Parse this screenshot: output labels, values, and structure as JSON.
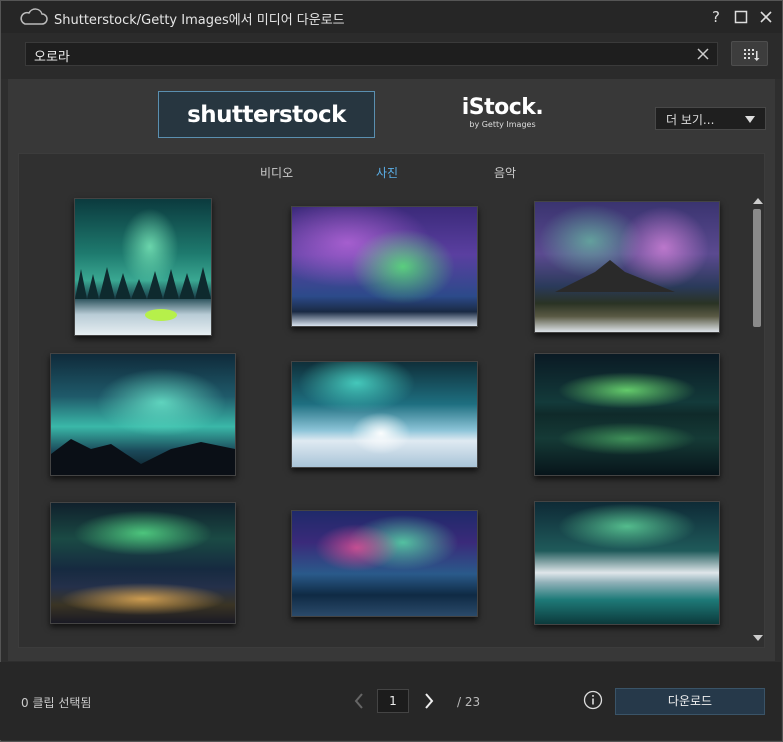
{
  "window": {
    "title": "Shutterstock/Getty Images에서 미디어 다운로드",
    "icons": [
      "cloud-icon",
      "help-icon",
      "maximize-icon",
      "close-icon"
    ]
  },
  "search": {
    "value": "오로라",
    "clear_icon": "close-icon",
    "view_icon": "grid-view-icon"
  },
  "providers": {
    "shutterstock": "shutterstock",
    "istock_main": "iStock.",
    "istock_sub": "by Getty Images",
    "more_label": "더 보기..."
  },
  "tabs": [
    {
      "label": "비디오",
      "active": false
    },
    {
      "label": "사진",
      "active": true
    },
    {
      "label": "음악",
      "active": false
    }
  ],
  "results": {
    "scroll_position": 0.0
  },
  "footer": {
    "selected": "0 클립 선택됨",
    "page": "1",
    "total": "/ 23",
    "download": "다운로드"
  },
  "colors": {
    "accent": "#5aaee6",
    "provider_border": "#5a8fb0",
    "download_bg": "#26394a"
  }
}
